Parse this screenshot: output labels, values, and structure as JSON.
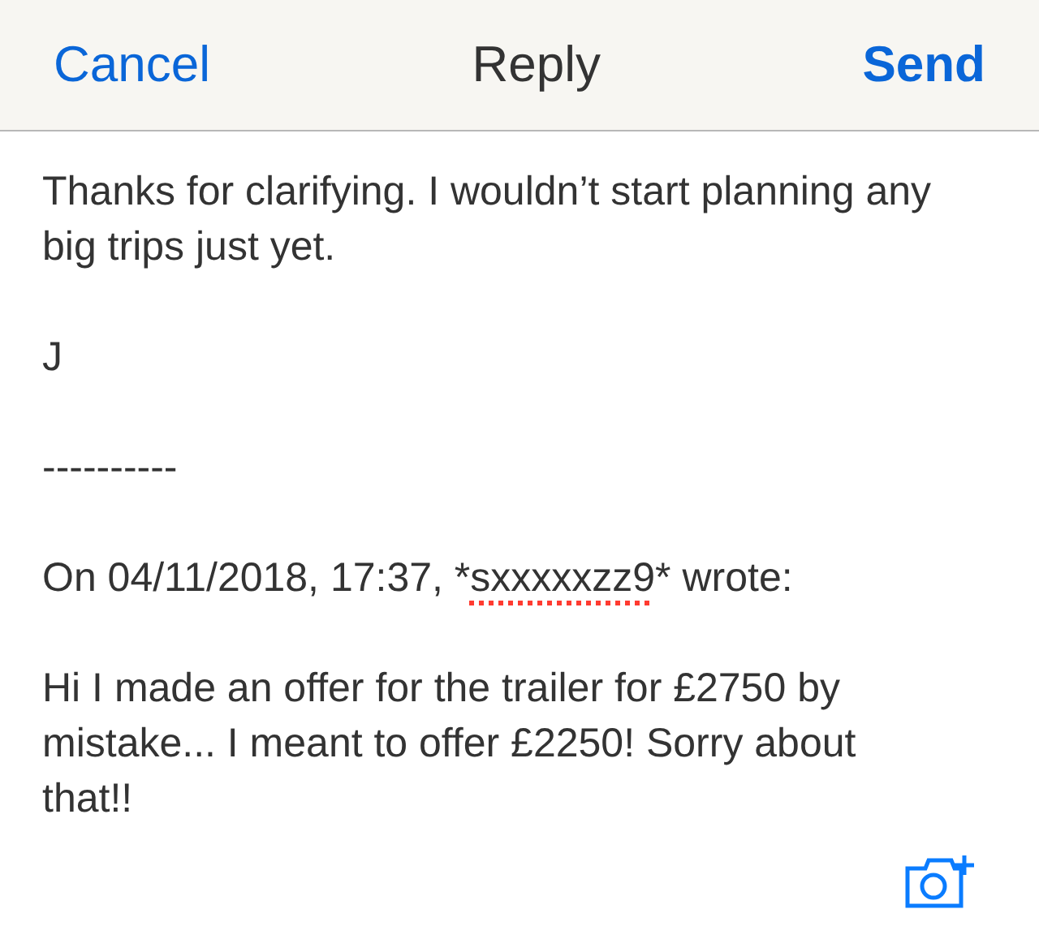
{
  "header": {
    "cancel": "Cancel",
    "title": "Reply",
    "send": "Send"
  },
  "body": [
    {
      "kind": "text",
      "text": "Thanks for clarifying. I wouldn’t start planning any big trips just yet."
    },
    {
      "kind": "text",
      "text": "J"
    },
    {
      "kind": "text",
      "text": "----------"
    },
    {
      "kind": "quote_header",
      "before": "On 04/11/2018, 17:37, *",
      "word": "sxxxxxzz9",
      "misspelled": true,
      "after": "* wrote:"
    },
    {
      "kind": "text",
      "text": "Hi I made an offer for the trailer for £2750 by mistake... I meant to offer £2250! Sorry about that!!"
    }
  ]
}
